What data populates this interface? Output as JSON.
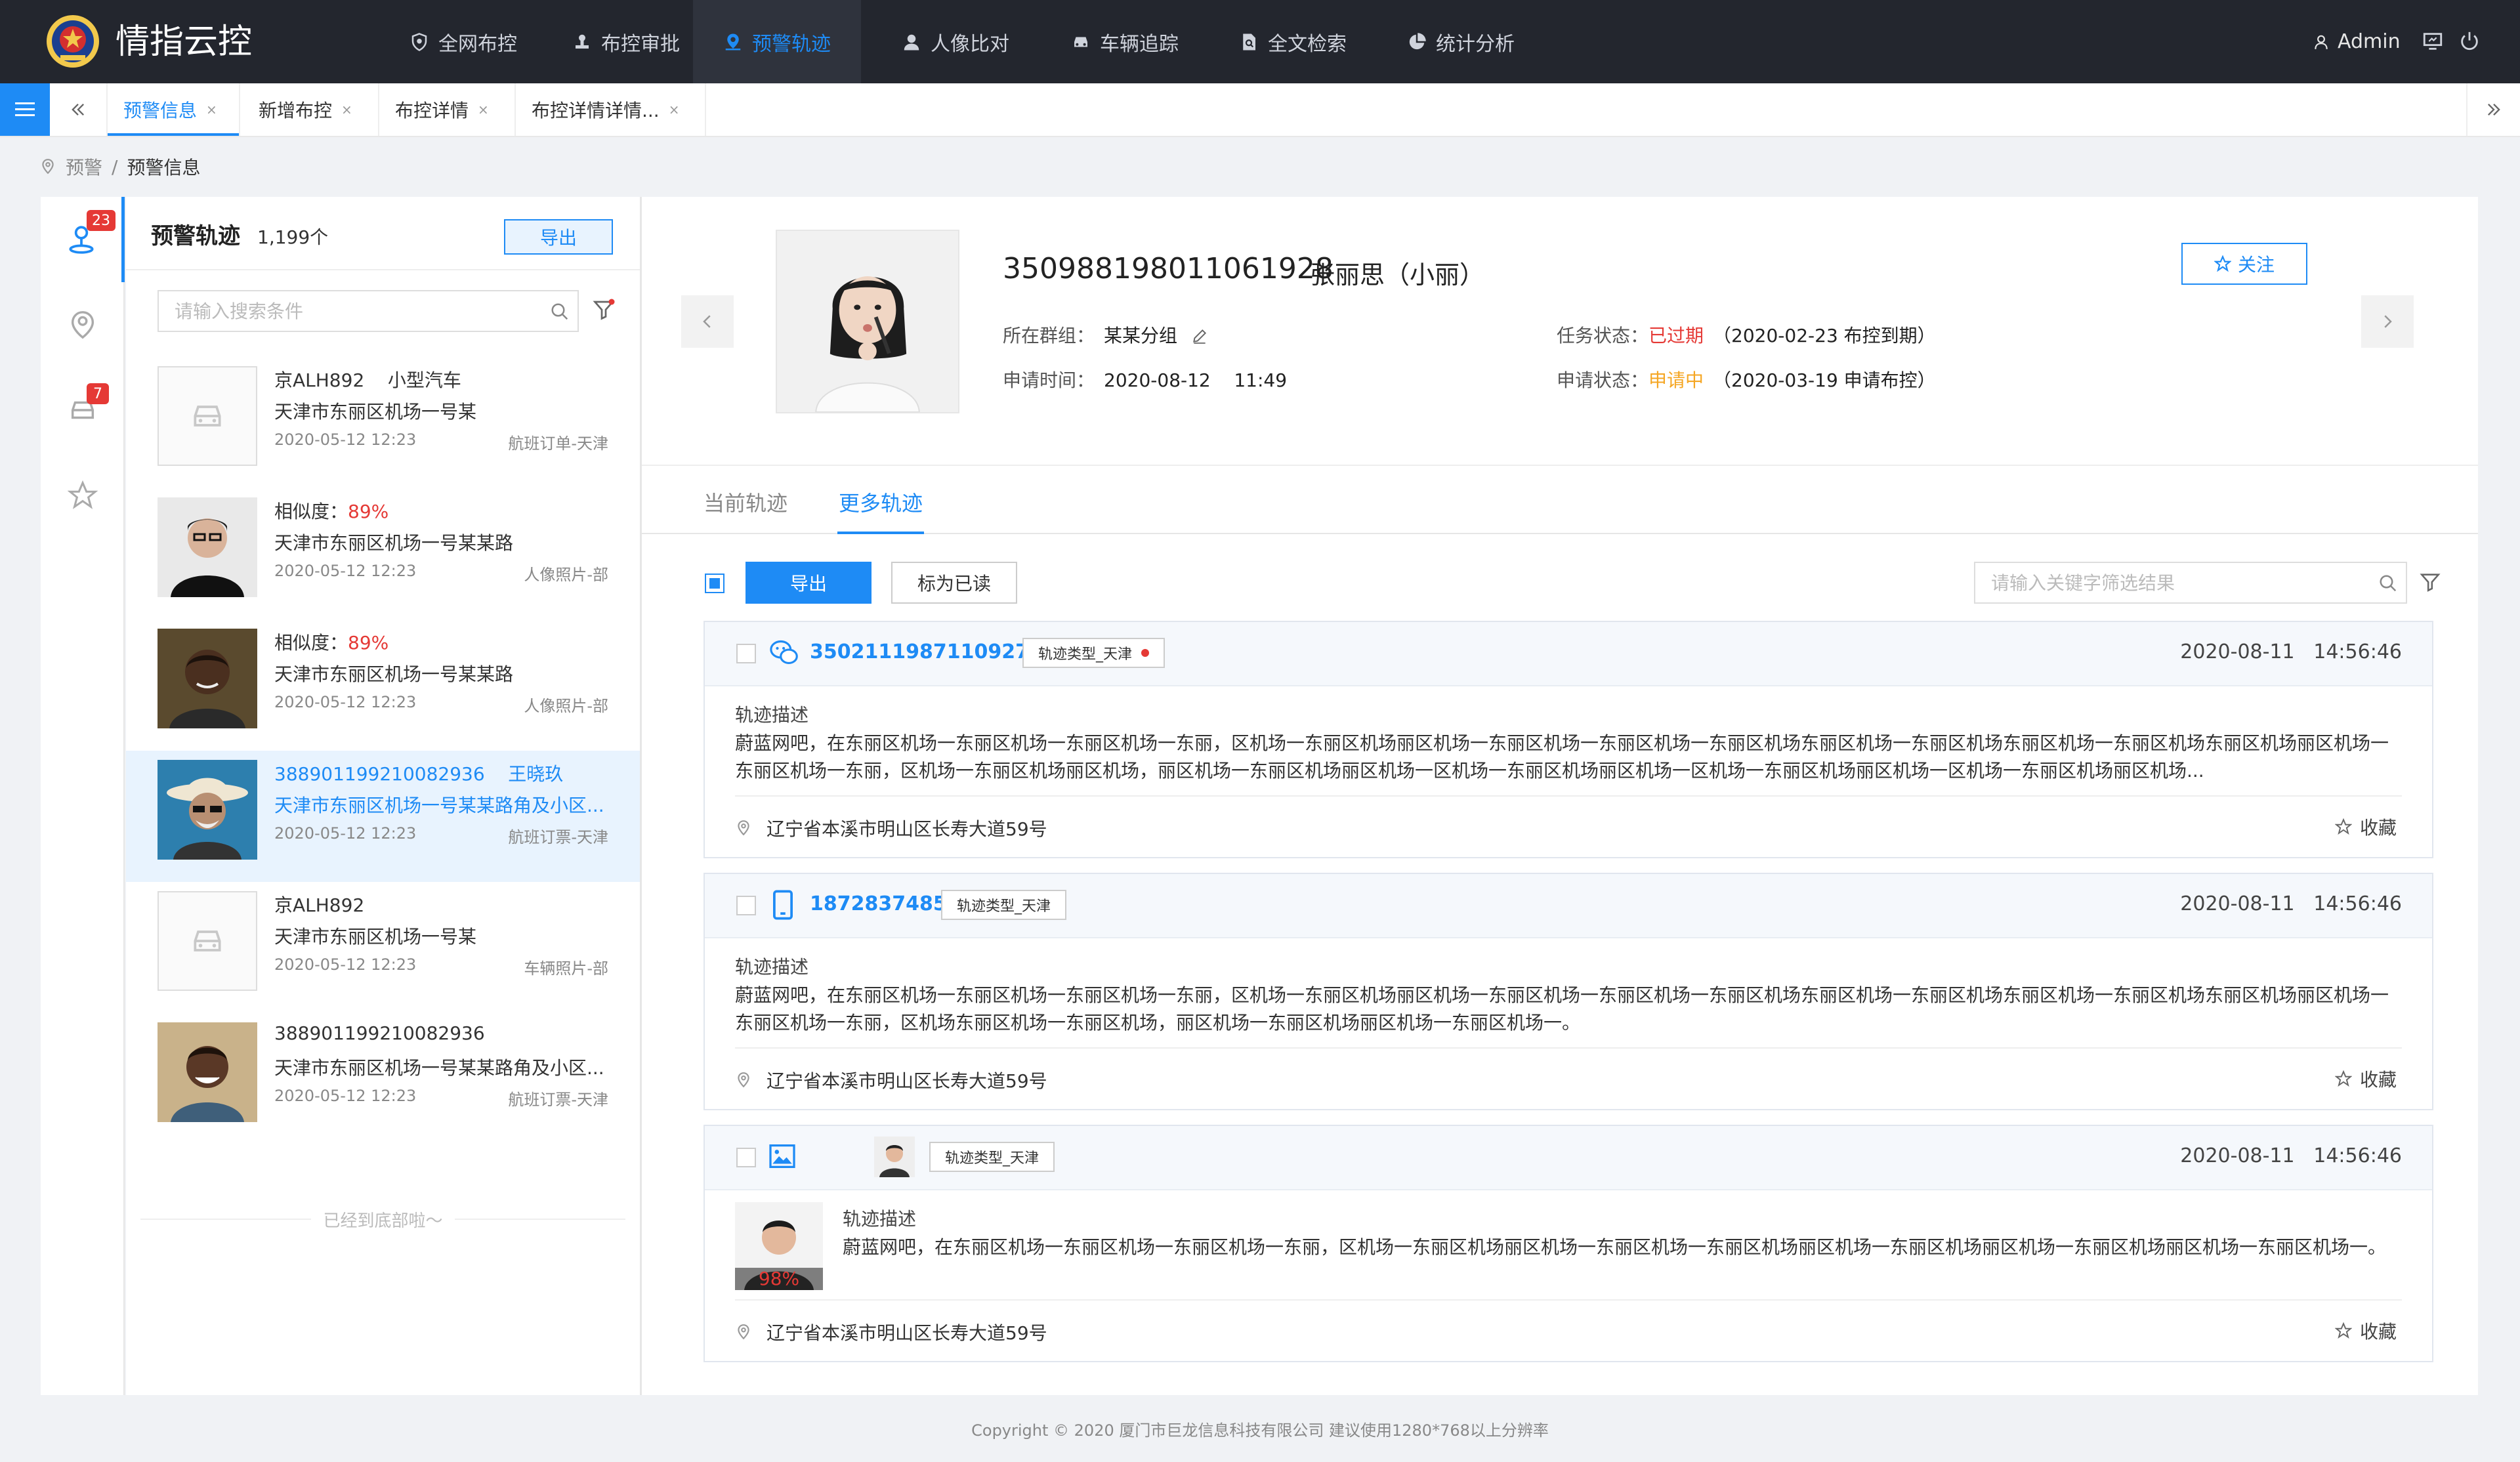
{
  "app": {
    "title": "情指云控"
  },
  "nav": [
    {
      "label": "全网布控",
      "icon": "shield-icon"
    },
    {
      "label": "布控审批",
      "icon": "stamp-icon"
    },
    {
      "label": "预警轨迹",
      "icon": "map-pin-icon",
      "active": true
    },
    {
      "label": "人像比对",
      "icon": "user-icon"
    },
    {
      "label": "车辆追踪",
      "icon": "car-icon"
    },
    {
      "label": "全文检索",
      "icon": "file-search-icon"
    },
    {
      "label": "统计分析",
      "icon": "pie-chart-icon"
    }
  ],
  "user": {
    "name": "Admin"
  },
  "tabs": [
    {
      "label": "预警信息",
      "close": "×",
      "active": true
    },
    {
      "label": "新增布控",
      "close": "×"
    },
    {
      "label": "布控详情",
      "close": "×"
    },
    {
      "label": "布控详情详情...",
      "close": "×"
    }
  ],
  "breadcrumb": {
    "parent": "预警",
    "sep": "/",
    "current": "预警信息"
  },
  "rail": {
    "badge_track": "23",
    "badge_vehicle": "7"
  },
  "list": {
    "title": "预警轨迹",
    "count": "1,199个",
    "export_label": "导出",
    "search_placeholder": "请输入搜索条件",
    "end_text": "已经到底部啦～",
    "items": [
      {
        "line1a": "京ALH892",
        "line1b": "小型汽车",
        "line2": "天津市东丽区机场一号某",
        "time": "2020-05-12  12:23",
        "source": "航班订单-天津"
      },
      {
        "line1a": "相似度：",
        "line1b": "89%",
        "line2": "天津市东丽区机场一号某某路",
        "time": "2020-05-12  12:23",
        "source": "人像照片-部"
      },
      {
        "line1a": "相似度：",
        "line1b": "89%",
        "line2": "天津市东丽区机场一号某某路",
        "time": "2020-05-12  12:23",
        "source": "人像照片-部"
      },
      {
        "line1a": "388901199210082936",
        "line1b": "王晓玖",
        "line2": "天津市东丽区机场一号某某路角及小区...",
        "time": "2020-05-12  12:23",
        "source": "航班订票-天津"
      },
      {
        "line1a": "京ALH892",
        "line1b": "",
        "line2": "天津市东丽区机场一号某",
        "time": "2020-05-12  12:23",
        "source": "车辆照片-部"
      },
      {
        "line1a": "388901199210082936",
        "line1b": "",
        "line2": "天津市东丽区机场一号某某路角及小区...",
        "time": "2020-05-12  12:23",
        "source": "航班订票-天津"
      }
    ]
  },
  "person": {
    "id": "350988198011061928",
    "name": "张丽思（小丽）",
    "group_label": "所在群组：",
    "group_value": "某某分组",
    "apply_time_label": "申请时间：",
    "apply_time_value": "2020-08-12    11:49",
    "task_status_label": "任务状态：",
    "task_status_value": "已过期",
    "task_status_note": "（2020-02-23  布控到期）",
    "apply_status_label": "申请状态：",
    "apply_status_value": "申请中",
    "apply_status_note": "（2020-03-19  申请布控）",
    "follow_label": "关注"
  },
  "detail_tabs": {
    "current": "当前轨迹",
    "more": "更多轨迹"
  },
  "toolbar": {
    "export_label": "导出",
    "mark_read_label": "标为已读",
    "filter_placeholder": "请输入关键字筛选结果"
  },
  "cards": [
    {
      "id": "350211198711092734",
      "type_icon": "wechat-icon",
      "tag": "轨迹类型_天津",
      "time": "2020-08-11   14:56:46",
      "desc_title": "轨迹描述",
      "desc": "蔚蓝网吧，在东丽区机场一东丽区机场一东丽区机场一东丽，区机场一东丽区机场丽区机场一东丽区机场一东丽区机场一东丽区机场东丽区机场一东丽区机场东丽区机场一东丽区机场东丽区机场丽区机场一东丽区机场一东丽，区机场一东丽区机场丽区机场，丽区机场一东丽区机场丽区机场一区机场一东丽区机场丽区机场一区机场一东丽区机场丽区机场一区机场一东丽区机场丽区机场...",
      "address": "辽宁省本溪市明山区长寿大道59号",
      "fav_label": "收藏"
    },
    {
      "id": "18728374859",
      "type_icon": "mobile-phone-icon",
      "tag": "轨迹类型_天津",
      "time": "2020-08-11   14:56:46",
      "desc_title": "轨迹描述",
      "desc": "蔚蓝网吧，在东丽区机场一东丽区机场一东丽区机场一东丽，区机场一东丽区机场丽区机场一东丽区机场一东丽区机场一东丽区机场东丽区机场一东丽区机场东丽区机场一东丽区机场东丽区机场丽区机场一东丽区机场一东丽，区机场东丽区机场一东丽区机场，丽区机场一东丽区机场丽区机场一东丽区机场一。",
      "address": "辽宁省本溪市明山区长寿大道59号",
      "fav_label": "收藏"
    },
    {
      "id": "",
      "type_icon": "image-icon",
      "tag": "轨迹类型_天津",
      "time": "2020-08-11   14:56:46",
      "desc_title": "轨迹描述",
      "desc": "蔚蓝网吧，在东丽区机场一东丽区机场一东丽区机场一东丽，区机场一东丽区机场丽区机场一东丽区机场一东丽区机场丽区机场一东丽区机场丽区机场一东丽区机场丽区机场一东丽区机场一。",
      "similarity": "98%",
      "address": "辽宁省本溪市明山区长寿大道59号",
      "fav_label": "收藏"
    }
  ],
  "footer": {
    "text": "Copyright © 2020  厦门市巨龙信息科技有限公司  建议使用1280*768以上分辨率"
  },
  "colors": {
    "accent": "#1e8bf5",
    "topbar": "#23262e",
    "alert": "#e53935",
    "pending": "#f5a623"
  }
}
